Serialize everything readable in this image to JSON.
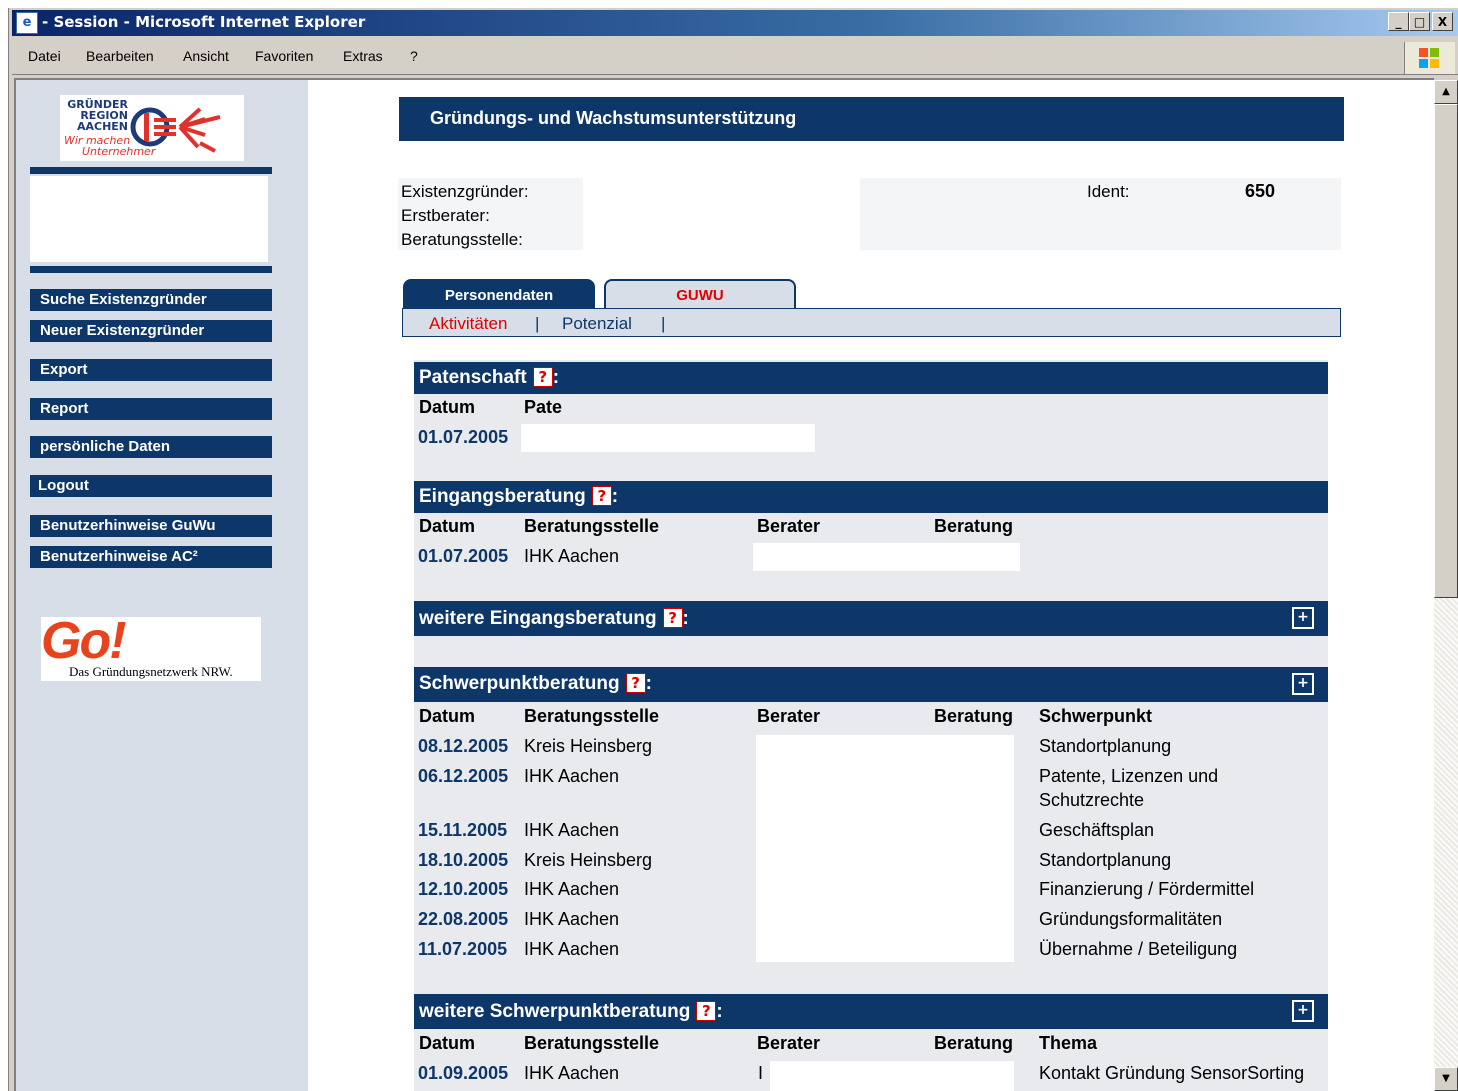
{
  "window": {
    "title": "- Session - Microsoft Internet Explorer",
    "minimize": "_",
    "maximize": "□",
    "close": "X"
  },
  "menu": [
    "Datei",
    "Bearbeiten",
    "Ansicht",
    "Favoriten",
    "Extras",
    "?"
  ],
  "sidebar": {
    "logo_lines": [
      "GRÜNDER",
      "REGION",
      "AACHEN",
      "Wir machen",
      "Unternehmer"
    ],
    "nav": [
      "Suche Existenzgründer",
      "Neuer Existenzgründer",
      "Export",
      "Report",
      "persönliche Daten",
      "Logout",
      "Benutzerhinweise GuWu",
      "Benutzerhinweise AC²"
    ],
    "go_logo": "Go!",
    "go_subtitle": "Das Gründungsnetzwerk NRW."
  },
  "header": {
    "banner": "Gründungs- und Wachstumsunterstützung",
    "labels": [
      "Existenzgründer:",
      "Erstberater:",
      "Beratungsstelle:"
    ],
    "ident_label": "Ident:",
    "ident_value": "650"
  },
  "tabs": [
    "Personendaten",
    "GUWU"
  ],
  "subtabs": [
    "Aktivitäten",
    "|",
    "Potenzial",
    "|"
  ],
  "sections": {
    "patenschaft": {
      "title": "Patenschaft",
      "suffix": ":",
      "columns": [
        "Datum",
        "Pate"
      ],
      "rows": [
        [
          "01.07.2005",
          ""
        ]
      ]
    },
    "eingang": {
      "title": "Eingangsberatung",
      "suffix": ":",
      "columns": [
        "Datum",
        "Beratungsstelle",
        "Berater",
        "Beratung"
      ],
      "rows": [
        [
          "01.07.2005",
          "IHK Aachen",
          "",
          ""
        ]
      ]
    },
    "weitere_eingang": {
      "title": "weitere Eingangsberatung",
      "suffix": ":"
    },
    "schwerpunkt": {
      "title": "Schwerpunktberatung",
      "suffix": ":",
      "columns": [
        "Datum",
        "Beratungsstelle",
        "Berater",
        "Beratung",
        "Schwerpunkt"
      ],
      "rows": [
        [
          "08.12.2005",
          "Kreis Heinsberg",
          "Standortplanung"
        ],
        [
          "06.12.2005",
          "IHK Aachen",
          "Patente, Lizenzen und"
        ],
        [
          "",
          "",
          "Schutzrechte"
        ],
        [
          "15.11.2005",
          "IHK Aachen",
          "Geschäftsplan"
        ],
        [
          "18.10.2005",
          "Kreis Heinsberg",
          "Standortplanung"
        ],
        [
          "12.10.2005",
          "IHK Aachen",
          "Finanzierung / Fördermittel"
        ],
        [
          "22.08.2005",
          "IHK Aachen",
          "Gründungsformalitäten"
        ],
        [
          "11.07.2005",
          "IHK Aachen",
          "Übernahme / Beteiligung"
        ]
      ]
    },
    "weitere_schwerpunkt": {
      "title": "weitere Schwerpunktberatung",
      "suffix": ":",
      "columns": [
        "Datum",
        "Beratungsstelle",
        "Berater",
        "Beratung",
        "Thema"
      ],
      "rows": [
        [
          "01.09.2005",
          "IHK Aachen",
          "I",
          "",
          "Kontakt Gründung SensorSorting"
        ]
      ]
    }
  },
  "qmark": "?",
  "expand_glyph": "+",
  "colors": {
    "navy": "#0e3769",
    "sidebar_bg": "#d8dee8",
    "active_red": "#e00000"
  }
}
